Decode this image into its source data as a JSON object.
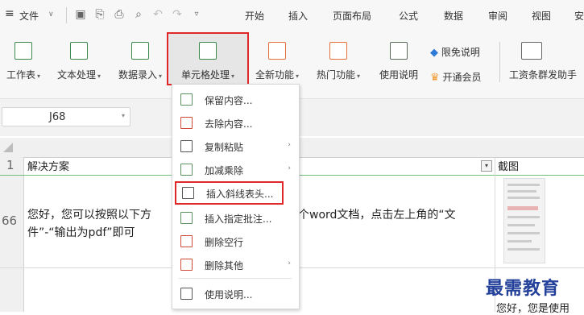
{
  "menu": {
    "hamburger": "≡",
    "file": "文件",
    "tabs": [
      "开始",
      "插入",
      "页面布局",
      "公式",
      "数据",
      "审阅",
      "视图",
      "安"
    ]
  },
  "ribbon": {
    "buttons": [
      {
        "label": "工作表",
        "icon": "worksheet-icon"
      },
      {
        "label": "文本处理",
        "icon": "text-process-icon"
      },
      {
        "label": "数据录入",
        "icon": "data-entry-icon"
      },
      {
        "label": "单元格处理",
        "icon": "cell-process-icon"
      },
      {
        "label": "全新功能",
        "icon": "new-feature-icon"
      },
      {
        "label": "热门功能",
        "icon": "hot-feature-icon"
      },
      {
        "label": "使用说明",
        "icon": "help-icon"
      }
    ],
    "promo": {
      "free": "限免说明",
      "vip": "开通会员"
    },
    "payroll": "工资条群发助手"
  },
  "namebox": {
    "value": "J68"
  },
  "grid": {
    "row1_num": "1",
    "row2_num": "66",
    "header_a": "解决方案",
    "header_b": "截图",
    "cell_line1": "您好，您可以按照以下方",
    "cell_line1_right": "个word文档，点击左上角的“文",
    "cell_line2": "件”-“输出为pdf”即可",
    "bottom_right": "您好，您是使用"
  },
  "dropdown": {
    "items": [
      {
        "label": "保留内容...",
        "submenu": false
      },
      {
        "label": "去除内容...",
        "submenu": false
      },
      {
        "label": "复制粘贴",
        "submenu": true
      },
      {
        "label": "加减乘除",
        "submenu": true
      },
      {
        "label": "插入斜线表头...",
        "submenu": false
      },
      {
        "label": "插入指定批注...",
        "submenu": false
      },
      {
        "label": "删除空行",
        "submenu": false
      },
      {
        "label": "删除其他",
        "submenu": true
      },
      {
        "label": "使用说明...",
        "submenu": false
      }
    ]
  },
  "watermark": "最需教育",
  "colors": {
    "accent_red": "#e02828",
    "icon_green": "#3b8a4b",
    "promo_blue": "#2f7ad6",
    "vip_orange": "#f29a2e"
  }
}
